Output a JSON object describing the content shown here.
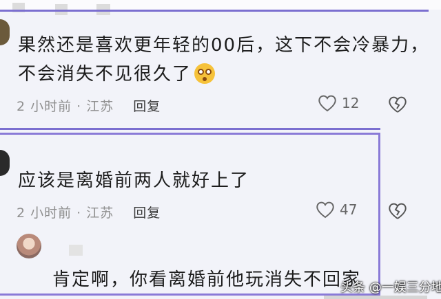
{
  "comments": [
    {
      "lines": [
        "果然还是喜欢更年轻的00后，这下不会冷暴力，",
        "不会消失不见很久了"
      ],
      "time_location": "2 小时前 · 江苏",
      "reply_label": "回复",
      "likes": "12"
    },
    {
      "lines": [
        "应该是离婚前两人就好上了"
      ],
      "time_location": "2 小时前 · 江苏",
      "reply_label": "回复",
      "likes": "47",
      "reply": {
        "text": "肯定啊，你看离婚前他玩消失不回家"
      }
    }
  ],
  "watermark": "头条 @一娱三分地",
  "colors": {
    "accent": "#8a7ad7",
    "meta": "#8f8f8f"
  },
  "icons": [
    "heart-outline-icon",
    "broken-heart-icon",
    "dizzy-face-emoji"
  ]
}
